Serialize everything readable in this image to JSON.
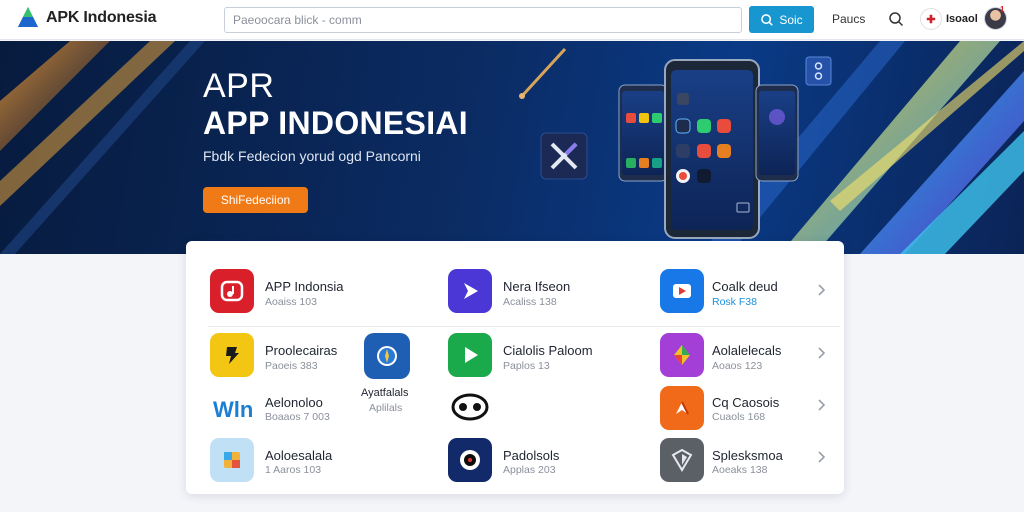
{
  "header": {
    "brand": "APK Indonesia",
    "search_placeholder": "Paeoocara blick - comm",
    "search_button": "Soic",
    "nav_link": "Paucs",
    "user_name": "Isoaol",
    "notif_badge": "1"
  },
  "hero": {
    "kicker": "APR",
    "title": "APP INDONESIAI",
    "subtitle": "Fbdk Fedecion yorud ogd Pancorni",
    "cta": "ShiFedeciion"
  },
  "featured_icon": "x-logo-icon",
  "apps": [
    {
      "name": "APP Indonsia",
      "meta": "Aoaiss 103",
      "icon": "music-icon",
      "color": "#d81f2a"
    },
    {
      "name": "Nera Ifseon",
      "meta": "Acaliss 138",
      "icon": "play-arrow-icon",
      "color": "#4a37d6"
    },
    {
      "name": "Coalk deud",
      "meta": "Rosk F38",
      "icon": "video-icon",
      "color": "#1878e8"
    },
    {
      "name": "Proolecairas",
      "meta": "Paoeis 383",
      "icon": "bolt-icon",
      "color": "#f3c613"
    },
    {
      "name": "Ayatfalals",
      "meta": "Aplilals",
      "icon": "compass-icon",
      "color": "#1e5fb4"
    },
    {
      "name": "Cialolis Paloom",
      "meta": "Paplos 13",
      "icon": "play-triangle-icon",
      "color": "#1aa94b"
    },
    {
      "name": "Aolalelecals",
      "meta": "Aoaos 123",
      "icon": "maps-icon",
      "color": "#a33ed6"
    },
    {
      "name": "Aelonoloo",
      "meta": "Boaaos 7 003",
      "icon": "wifi-logo-icon",
      "color": "#ffffff"
    },
    {
      "name": "",
      "meta": "",
      "icon": "glasses-icon",
      "color": "#ffffff"
    },
    {
      "name": "Cq Caosois",
      "meta": "Cuaols 168",
      "icon": "arrow-up-icon",
      "color": "#f06a1a"
    },
    {
      "name": "Aoloesalala",
      "meta": "1 Aaros 103",
      "icon": "cube-icon",
      "color": "#bfe0f5"
    },
    {
      "name": "Padolsols",
      "meta": "Applas 203",
      "icon": "record-icon",
      "color": "#132a6a"
    },
    {
      "name": "Splesksmoa",
      "meta": "Aoeaks 138",
      "icon": "shield-icon",
      "color": "#5b5f66"
    }
  ]
}
